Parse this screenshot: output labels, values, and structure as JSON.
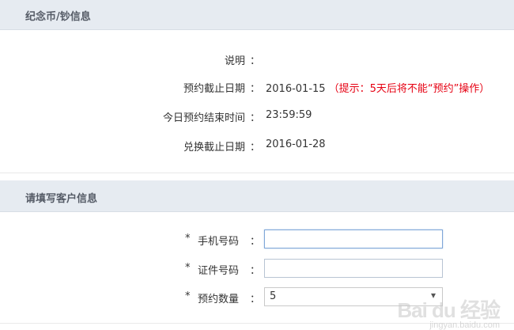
{
  "coin_info": {
    "title": "纪念币/钞信息",
    "rows": [
      {
        "label": "说明",
        "colon": "：",
        "value": "",
        "note": ""
      },
      {
        "label": "预约截止日期",
        "colon": "：",
        "value": "2016-01-15",
        "note": "（提示：5天后将不能“预约”操作）"
      },
      {
        "label": "今日预约结束时间",
        "colon": "：",
        "value": "23:59:59",
        "note": ""
      },
      {
        "label": "兑换截止日期",
        "colon": "：",
        "value": "2016-01-28",
        "note": ""
      }
    ]
  },
  "customer_info": {
    "title": "请填写客户信息",
    "fields": [
      {
        "required": "*",
        "label": "手机号码",
        "colon": "：",
        "value": ""
      },
      {
        "required": "*",
        "label": "证件号码",
        "colon": "：",
        "value": ""
      },
      {
        "required": "*",
        "label": "预约数量",
        "colon": "：",
        "value": "5"
      }
    ]
  },
  "watermark": {
    "brand": "Bai du 经验",
    "url": "jingyan.baidu.com"
  },
  "colors": {
    "header_bg": "#e6ebf1",
    "note_red": "#e60012"
  }
}
